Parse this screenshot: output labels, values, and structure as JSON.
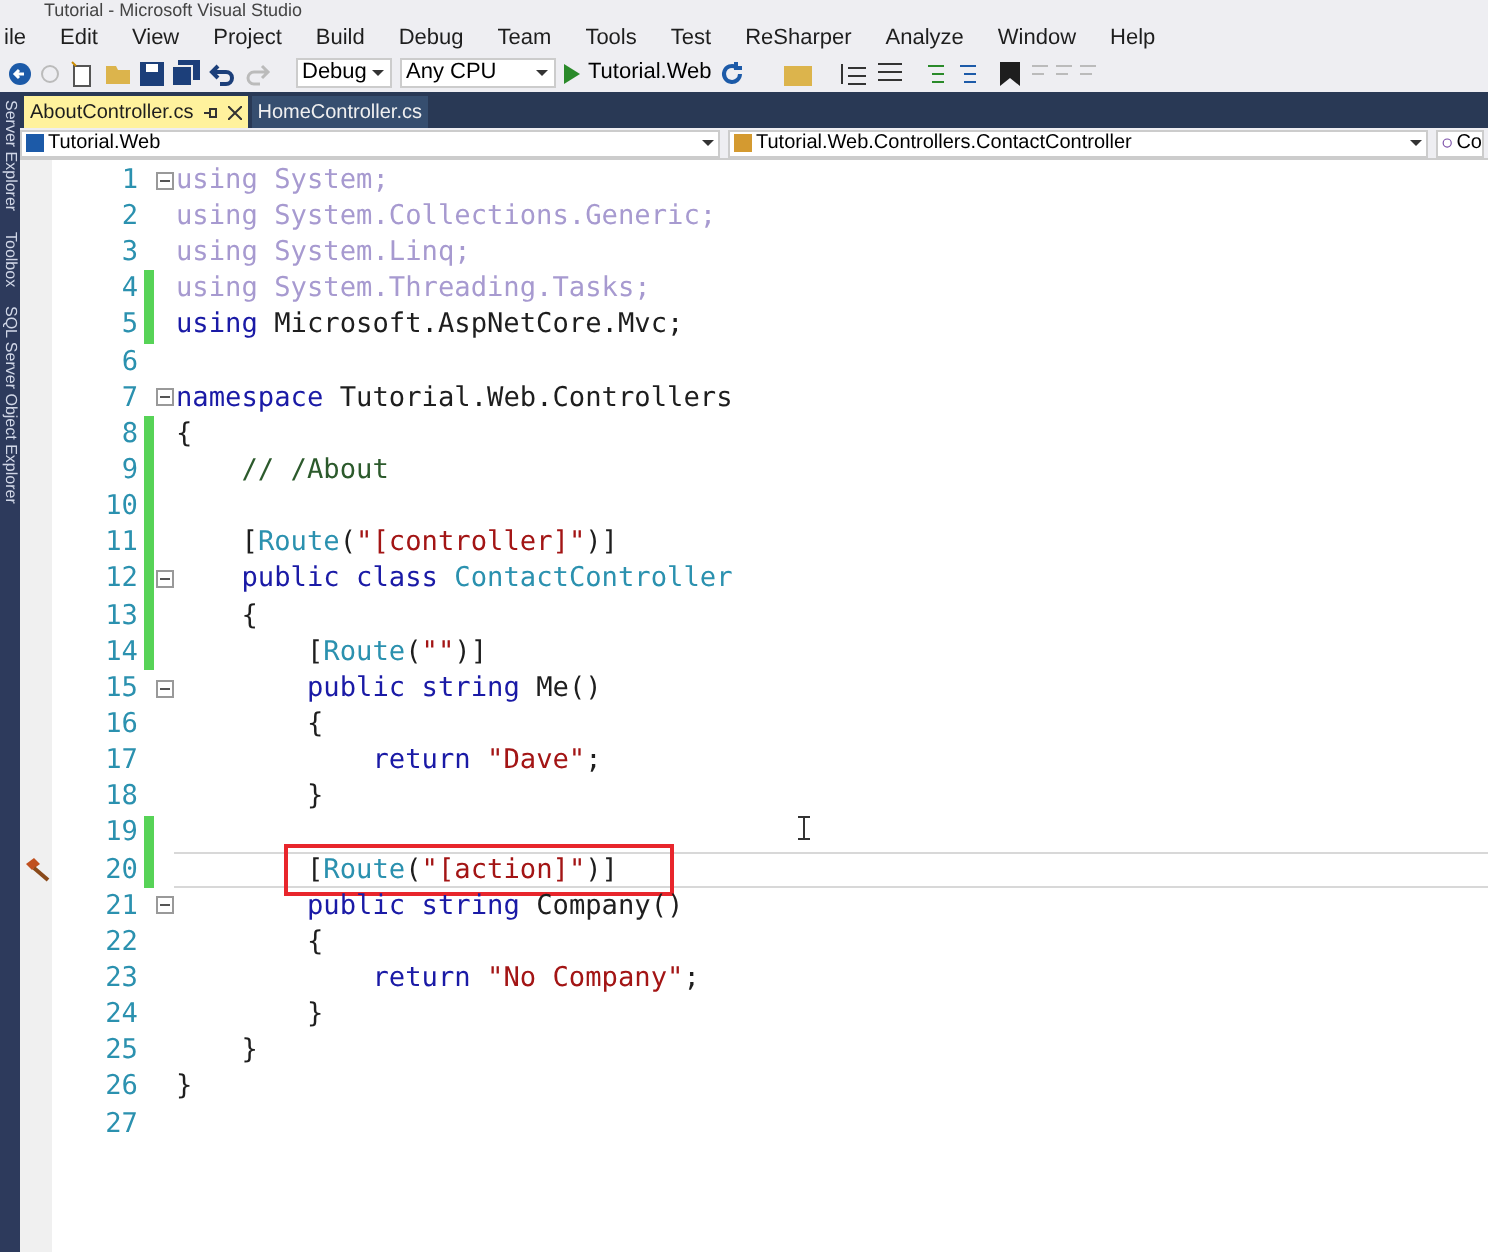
{
  "window": {
    "title": "Tutorial - Microsoft Visual Studio"
  },
  "menu": [
    "ile",
    "Edit",
    "View",
    "Project",
    "Build",
    "Debug",
    "Team",
    "Tools",
    "Test",
    "ReSharper",
    "Analyze",
    "Window",
    "Help"
  ],
  "toolbar": {
    "configuration": "Debug",
    "platform": "Any CPU",
    "start_target": "Tutorial.Web"
  },
  "side_panels": [
    "Server Explorer",
    "Toolbox",
    "SQL Server Object Explorer"
  ],
  "tabs": [
    {
      "label": "AboutController.cs",
      "selected": true
    },
    {
      "label": "HomeController.cs",
      "selected": false
    }
  ],
  "navigation": {
    "project": "Tutorial.Web",
    "type": "Tutorial.Web.Controllers.ContactController",
    "member": "Co"
  },
  "editor": {
    "lines": [
      {
        "number": "1",
        "current": false,
        "changed": false,
        "fold": true,
        "tokens": [
          {
            "kind": "faded",
            "text": "using System;"
          }
        ]
      },
      {
        "number": "2",
        "current": false,
        "changed": false,
        "fold": false,
        "tokens": [
          {
            "kind": "faded",
            "text": "using System.Collections.Generic;"
          }
        ]
      },
      {
        "number": "3",
        "current": false,
        "changed": false,
        "fold": false,
        "tokens": [
          {
            "kind": "faded",
            "text": "using System.Linq;"
          }
        ]
      },
      {
        "number": "4",
        "current": false,
        "changed": true,
        "fold": false,
        "tokens": [
          {
            "kind": "faded",
            "text": "using System.Threading.Tasks;"
          }
        ]
      },
      {
        "number": "5",
        "current": false,
        "changed": true,
        "fold": false,
        "tokens": [
          {
            "kind": "keyword",
            "text": "using"
          },
          {
            "kind": "plain",
            "text": " Microsoft.AspNetCore.Mvc;"
          }
        ]
      },
      {
        "number": "6",
        "current": false,
        "changed": false,
        "fold": false
      },
      {
        "number": "7",
        "current": false,
        "changed": false,
        "fold": true,
        "tokens": [
          {
            "kind": "keyword",
            "text": "namespace"
          },
          {
            "kind": "plain",
            "text": " Tutorial.Web.Controllers"
          }
        ]
      },
      {
        "number": "8",
        "current": false,
        "changed": true,
        "fold": false,
        "tokens": [
          {
            "kind": "plain",
            "text": "{"
          }
        ]
      },
      {
        "number": "9",
        "current": false,
        "changed": true,
        "fold": false,
        "tokens": [
          {
            "kind": "comment",
            "text": "    // /About"
          }
        ]
      },
      {
        "number": "10",
        "current": false,
        "changed": true,
        "fold": false
      },
      {
        "number": "11",
        "current": false,
        "changed": true,
        "fold": false,
        "tokens": [
          {
            "kind": "plain",
            "text": "    ["
          },
          {
            "kind": "type",
            "text": "Route"
          },
          {
            "kind": "plain",
            "text": "("
          },
          {
            "kind": "string",
            "text": "\"[controller]\""
          },
          {
            "kind": "plain",
            "text": ")]"
          }
        ]
      },
      {
        "number": "12",
        "current": false,
        "changed": true,
        "fold": true,
        "tokens": [
          {
            "kind": "keyword",
            "text": "    public class"
          },
          {
            "kind": "type",
            "text": " ContactController"
          }
        ]
      },
      {
        "number": "13",
        "current": false,
        "changed": true,
        "fold": false,
        "tokens": [
          {
            "kind": "plain",
            "text": "    {"
          }
        ]
      },
      {
        "number": "14",
        "current": false,
        "changed": true,
        "fold": false,
        "tokens": [
          {
            "kind": "plain",
            "text": "        ["
          },
          {
            "kind": "type",
            "text": "Route"
          },
          {
            "kind": "plain",
            "text": "("
          },
          {
            "kind": "string",
            "text": "\"\""
          },
          {
            "kind": "plain",
            "text": ")]"
          }
        ]
      },
      {
        "number": "15",
        "current": false,
        "changed": false,
        "fold": true,
        "tokens": [
          {
            "kind": "keyword",
            "text": "        public string"
          },
          {
            "kind": "plain",
            "text": " Me()"
          }
        ]
      },
      {
        "number": "16",
        "current": false,
        "changed": false,
        "fold": false,
        "tokens": [
          {
            "kind": "plain",
            "text": "        {"
          }
        ]
      },
      {
        "number": "17",
        "current": false,
        "changed": false,
        "fold": false,
        "tokens": [
          {
            "kind": "keyword",
            "text": "            return"
          },
          {
            "kind": "string",
            "text": " \"Dave\""
          },
          {
            "kind": "plain",
            "text": ";"
          }
        ]
      },
      {
        "number": "18",
        "current": false,
        "changed": false,
        "fold": false,
        "tokens": [
          {
            "kind": "plain",
            "text": "        }"
          }
        ]
      },
      {
        "number": "19",
        "current": false,
        "changed": true,
        "fold": false
      },
      {
        "number": "20",
        "current": true,
        "changed": true,
        "fold": false,
        "tokens": [
          {
            "kind": "plain",
            "text": "        ["
          },
          {
            "kind": "type",
            "text": "Route"
          },
          {
            "kind": "plain",
            "text": "("
          },
          {
            "kind": "string",
            "text": "\"[action]\""
          },
          {
            "kind": "plain",
            "text": ")]"
          }
        ]
      },
      {
        "number": "21",
        "current": false,
        "changed": false,
        "fold": true,
        "tokens": [
          {
            "kind": "keyword",
            "text": "        public string"
          },
          {
            "kind": "plain",
            "text": " Company()"
          }
        ]
      },
      {
        "number": "22",
        "current": false,
        "changed": false,
        "fold": false,
        "tokens": [
          {
            "kind": "plain",
            "text": "        {"
          }
        ]
      },
      {
        "number": "23",
        "current": false,
        "changed": false,
        "fold": false,
        "tokens": [
          {
            "kind": "keyword",
            "text": "            return"
          },
          {
            "kind": "string",
            "text": " \"No Company\""
          },
          {
            "kind": "plain",
            "text": ";"
          }
        ]
      },
      {
        "number": "24",
        "current": false,
        "changed": false,
        "fold": false,
        "tokens": [
          {
            "kind": "plain",
            "text": "        }"
          }
        ]
      },
      {
        "number": "25",
        "current": false,
        "changed": false,
        "fold": false,
        "tokens": [
          {
            "kind": "plain",
            "text": "    }"
          }
        ]
      },
      {
        "number": "26",
        "current": false,
        "changed": false,
        "fold": false,
        "tokens": [
          {
            "kind": "plain",
            "text": "}"
          }
        ]
      },
      {
        "number": "27",
        "current": false,
        "changed": false,
        "fold": false
      }
    ]
  }
}
